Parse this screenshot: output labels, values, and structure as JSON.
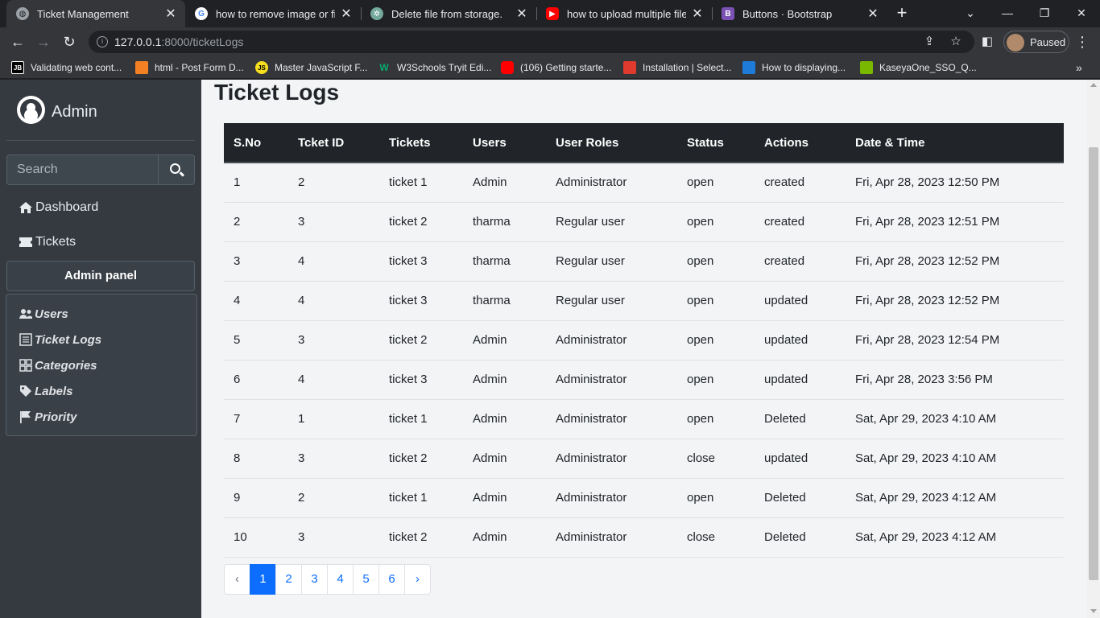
{
  "browser": {
    "tabs": [
      {
        "title": "Ticket Management",
        "icon": "globe-icon",
        "active": true
      },
      {
        "title": "how to remove image or file",
        "icon": "google-icon",
        "active": false
      },
      {
        "title": "Delete file from storage.",
        "icon": "chatgpt-icon",
        "active": false
      },
      {
        "title": "how to upload multiple files",
        "icon": "youtube-icon",
        "active": false
      },
      {
        "title": "Buttons · Bootstrap",
        "icon": "bootstrap-icon",
        "active": false
      }
    ],
    "url_host": "127.0.0.1",
    "url_rest": ":8000/ticketLogs",
    "profile_status": "Paused",
    "bookmarks": [
      {
        "label": "Validating web cont...",
        "icon_text": "JB",
        "color": "#000000"
      },
      {
        "label": "html - Post Form D...",
        "icon_text": "",
        "color": "#f48024"
      },
      {
        "label": "Master JavaScript F...",
        "icon_text": "JS",
        "color": "#f7df1e"
      },
      {
        "label": "W3Schools Tryit Edi...",
        "icon_text": "W",
        "color": "#04aa6d"
      },
      {
        "label": "(106) Getting starte...",
        "icon_text": "",
        "color": "#ff0000"
      },
      {
        "label": "Installation | Select...",
        "icon_text": "",
        "color": "#e03a2f"
      },
      {
        "label": "How to displaying...",
        "icon_text": "",
        "color": "#1f7bd8"
      },
      {
        "label": "KaseyaOne_SSO_Q...",
        "icon_text": "",
        "color": "#7ab800"
      }
    ]
  },
  "sidebar": {
    "brand": "Admin",
    "search_placeholder": "Search",
    "nav": [
      {
        "label": "Dashboard",
        "icon": "home-icon"
      },
      {
        "label": "Tickets",
        "icon": "ticket-icon"
      }
    ],
    "admin_panel_label": "Admin panel",
    "submenu": [
      {
        "label": "Users",
        "icon": "users-icon"
      },
      {
        "label": "Ticket Logs",
        "icon": "list-icon"
      },
      {
        "label": "Categories",
        "icon": "grid-icon"
      },
      {
        "label": "Labels",
        "icon": "tag-icon"
      },
      {
        "label": "Priority",
        "icon": "flag-icon"
      }
    ]
  },
  "main": {
    "title": "Ticket Logs",
    "table": {
      "headers": [
        "S.No",
        "Tcket ID",
        "Tickets",
        "Users",
        "User Roles",
        "Status",
        "Actions",
        "Date & Time"
      ],
      "rows": [
        [
          "1",
          "2",
          "ticket 1",
          "Admin",
          "Administrator",
          "open",
          "created",
          "Fri, Apr 28, 2023 12:50 PM"
        ],
        [
          "2",
          "3",
          "ticket 2",
          "tharma",
          "Regular user",
          "open",
          "created",
          "Fri, Apr 28, 2023 12:51 PM"
        ],
        [
          "3",
          "4",
          "ticket 3",
          "tharma",
          "Regular user",
          "open",
          "created",
          "Fri, Apr 28, 2023 12:52 PM"
        ],
        [
          "4",
          "4",
          "ticket 3",
          "tharma",
          "Regular user",
          "open",
          "updated",
          "Fri, Apr 28, 2023 12:52 PM"
        ],
        [
          "5",
          "3",
          "ticket 2",
          "Admin",
          "Administrator",
          "open",
          "updated",
          "Fri, Apr 28, 2023 12:54 PM"
        ],
        [
          "6",
          "4",
          "ticket 3",
          "Admin",
          "Administrator",
          "open",
          "updated",
          "Fri, Apr 28, 2023 3:56 PM"
        ],
        [
          "7",
          "1",
          "ticket 1",
          "Admin",
          "Administrator",
          "open",
          "Deleted",
          "Sat, Apr 29, 2023 4:10 AM"
        ],
        [
          "8",
          "3",
          "ticket 2",
          "Admin",
          "Administrator",
          "close",
          "updated",
          "Sat, Apr 29, 2023 4:10 AM"
        ],
        [
          "9",
          "2",
          "ticket 1",
          "Admin",
          "Administrator",
          "open",
          "Deleted",
          "Sat, Apr 29, 2023 4:12 AM"
        ],
        [
          "10",
          "3",
          "ticket 2",
          "Admin",
          "Administrator",
          "close",
          "Deleted",
          "Sat, Apr 29, 2023 4:12 AM"
        ]
      ]
    },
    "pagination": {
      "prev": "‹",
      "pages": [
        "1",
        "2",
        "3",
        "4",
        "5",
        "6"
      ],
      "next": "›",
      "active": "1"
    }
  },
  "colors": {
    "sidebar_bg": "#343a40",
    "table_header_bg": "#212529",
    "accent": "#0d6efd"
  }
}
